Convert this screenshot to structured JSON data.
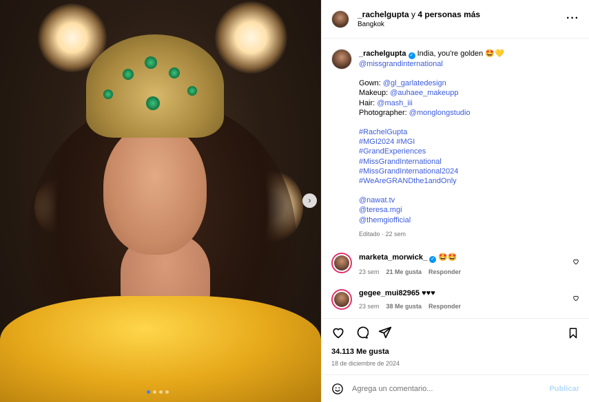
{
  "post": {
    "header": {
      "username": "_rachelgupta",
      "collab_suffix": " y ",
      "collab_count": "4 personas más",
      "location": "Bangkok",
      "more_icon": "···"
    },
    "caption": {
      "username": "_rachelgupta",
      "text": "India, you're golden 🤩💛",
      "mention_org": "@missgrandinternational",
      "credits": [
        {
          "label": "Gown:",
          "handle": "@gl_garlatedesign"
        },
        {
          "label": "Makeup:",
          "handle": "@auhaee_makeupp"
        },
        {
          "label": "Hair:",
          "handle": "@mash_iii"
        },
        {
          "label": "Photographer:",
          "handle": "@monglongstudio"
        }
      ],
      "hashtags": [
        "#RachelGupta",
        "#MGI2024 #MGI",
        "#GrandExperiences",
        "#MissGrandInternational",
        "#MissGrandInternational2024",
        "#WeAreGRANDthe1andOnly"
      ],
      "mentions": [
        "@nawat.tv",
        "@teresa.mgi",
        "@themgiofficial"
      ],
      "edited": "Editado · 22 sem"
    },
    "comments": [
      {
        "username": "marketa_morwick_",
        "text": "🤩🤩",
        "time": "23 sem",
        "likes": "21 Me gusta",
        "reply": "Responder",
        "verified": true
      },
      {
        "username": "gegee_mui82965",
        "text": "♥♥♥",
        "time": "23 sem",
        "likes": "38 Me gusta",
        "reply": "Responder",
        "verified": false
      }
    ],
    "likes": "34.113 Me gusta",
    "date": "18 de diciembre de 2024",
    "composer": {
      "placeholder": "Agrega un comentario...",
      "publish": "Publicar"
    },
    "carousel": {
      "next": "›",
      "slides": 4,
      "current": 1
    }
  }
}
